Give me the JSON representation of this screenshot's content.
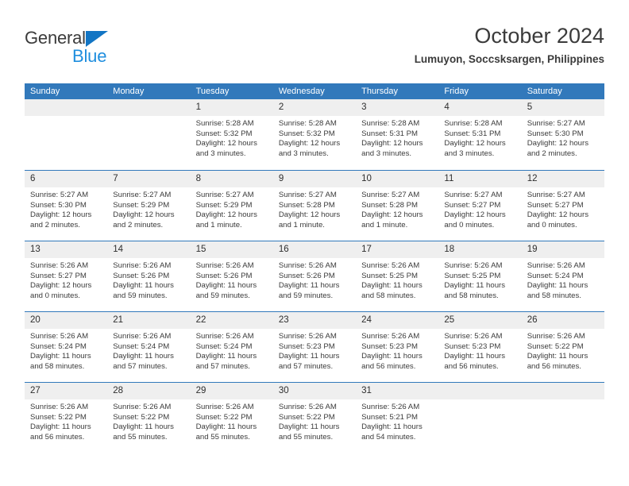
{
  "brand": {
    "name_top": "General",
    "name_bottom": "Blue",
    "colors": {
      "top_text": "#3b3b3b",
      "bottom_text": "#1f8ede",
      "triangle": "#1275c4"
    }
  },
  "header": {
    "title": "October 2024",
    "subtitle": "Lumuyon, Soccsksargen, Philippines"
  },
  "theme": {
    "header_blue": "#3279bb",
    "daynum_band": "#efefef",
    "text": "#3b3b3b"
  },
  "weekdays": [
    "Sunday",
    "Monday",
    "Tuesday",
    "Wednesday",
    "Thursday",
    "Friday",
    "Saturday"
  ],
  "weeks": [
    [
      {
        "day": "",
        "sunrise": "",
        "sunset": "",
        "daylight_line1": "",
        "daylight_line2": "",
        "empty": true
      },
      {
        "day": "",
        "sunrise": "",
        "sunset": "",
        "daylight_line1": "",
        "daylight_line2": "",
        "empty": true
      },
      {
        "day": "1",
        "sunrise": "Sunrise: 5:28 AM",
        "sunset": "Sunset: 5:32 PM",
        "daylight_line1": "Daylight: 12 hours",
        "daylight_line2": "and 3 minutes."
      },
      {
        "day": "2",
        "sunrise": "Sunrise: 5:28 AM",
        "sunset": "Sunset: 5:32 PM",
        "daylight_line1": "Daylight: 12 hours",
        "daylight_line2": "and 3 minutes."
      },
      {
        "day": "3",
        "sunrise": "Sunrise: 5:28 AM",
        "sunset": "Sunset: 5:31 PM",
        "daylight_line1": "Daylight: 12 hours",
        "daylight_line2": "and 3 minutes."
      },
      {
        "day": "4",
        "sunrise": "Sunrise: 5:28 AM",
        "sunset": "Sunset: 5:31 PM",
        "daylight_line1": "Daylight: 12 hours",
        "daylight_line2": "and 3 minutes."
      },
      {
        "day": "5",
        "sunrise": "Sunrise: 5:27 AM",
        "sunset": "Sunset: 5:30 PM",
        "daylight_line1": "Daylight: 12 hours",
        "daylight_line2": "and 2 minutes."
      }
    ],
    [
      {
        "day": "6",
        "sunrise": "Sunrise: 5:27 AM",
        "sunset": "Sunset: 5:30 PM",
        "daylight_line1": "Daylight: 12 hours",
        "daylight_line2": "and 2 minutes."
      },
      {
        "day": "7",
        "sunrise": "Sunrise: 5:27 AM",
        "sunset": "Sunset: 5:29 PM",
        "daylight_line1": "Daylight: 12 hours",
        "daylight_line2": "and 2 minutes."
      },
      {
        "day": "8",
        "sunrise": "Sunrise: 5:27 AM",
        "sunset": "Sunset: 5:29 PM",
        "daylight_line1": "Daylight: 12 hours",
        "daylight_line2": "and 1 minute."
      },
      {
        "day": "9",
        "sunrise": "Sunrise: 5:27 AM",
        "sunset": "Sunset: 5:28 PM",
        "daylight_line1": "Daylight: 12 hours",
        "daylight_line2": "and 1 minute."
      },
      {
        "day": "10",
        "sunrise": "Sunrise: 5:27 AM",
        "sunset": "Sunset: 5:28 PM",
        "daylight_line1": "Daylight: 12 hours",
        "daylight_line2": "and 1 minute."
      },
      {
        "day": "11",
        "sunrise": "Sunrise: 5:27 AM",
        "sunset": "Sunset: 5:27 PM",
        "daylight_line1": "Daylight: 12 hours",
        "daylight_line2": "and 0 minutes."
      },
      {
        "day": "12",
        "sunrise": "Sunrise: 5:27 AM",
        "sunset": "Sunset: 5:27 PM",
        "daylight_line1": "Daylight: 12 hours",
        "daylight_line2": "and 0 minutes."
      }
    ],
    [
      {
        "day": "13",
        "sunrise": "Sunrise: 5:26 AM",
        "sunset": "Sunset: 5:27 PM",
        "daylight_line1": "Daylight: 12 hours",
        "daylight_line2": "and 0 minutes."
      },
      {
        "day": "14",
        "sunrise": "Sunrise: 5:26 AM",
        "sunset": "Sunset: 5:26 PM",
        "daylight_line1": "Daylight: 11 hours",
        "daylight_line2": "and 59 minutes."
      },
      {
        "day": "15",
        "sunrise": "Sunrise: 5:26 AM",
        "sunset": "Sunset: 5:26 PM",
        "daylight_line1": "Daylight: 11 hours",
        "daylight_line2": "and 59 minutes."
      },
      {
        "day": "16",
        "sunrise": "Sunrise: 5:26 AM",
        "sunset": "Sunset: 5:26 PM",
        "daylight_line1": "Daylight: 11 hours",
        "daylight_line2": "and 59 minutes."
      },
      {
        "day": "17",
        "sunrise": "Sunrise: 5:26 AM",
        "sunset": "Sunset: 5:25 PM",
        "daylight_line1": "Daylight: 11 hours",
        "daylight_line2": "and 58 minutes."
      },
      {
        "day": "18",
        "sunrise": "Sunrise: 5:26 AM",
        "sunset": "Sunset: 5:25 PM",
        "daylight_line1": "Daylight: 11 hours",
        "daylight_line2": "and 58 minutes."
      },
      {
        "day": "19",
        "sunrise": "Sunrise: 5:26 AM",
        "sunset": "Sunset: 5:24 PM",
        "daylight_line1": "Daylight: 11 hours",
        "daylight_line2": "and 58 minutes."
      }
    ],
    [
      {
        "day": "20",
        "sunrise": "Sunrise: 5:26 AM",
        "sunset": "Sunset: 5:24 PM",
        "daylight_line1": "Daylight: 11 hours",
        "daylight_line2": "and 58 minutes."
      },
      {
        "day": "21",
        "sunrise": "Sunrise: 5:26 AM",
        "sunset": "Sunset: 5:24 PM",
        "daylight_line1": "Daylight: 11 hours",
        "daylight_line2": "and 57 minutes."
      },
      {
        "day": "22",
        "sunrise": "Sunrise: 5:26 AM",
        "sunset": "Sunset: 5:24 PM",
        "daylight_line1": "Daylight: 11 hours",
        "daylight_line2": "and 57 minutes."
      },
      {
        "day": "23",
        "sunrise": "Sunrise: 5:26 AM",
        "sunset": "Sunset: 5:23 PM",
        "daylight_line1": "Daylight: 11 hours",
        "daylight_line2": "and 57 minutes."
      },
      {
        "day": "24",
        "sunrise": "Sunrise: 5:26 AM",
        "sunset": "Sunset: 5:23 PM",
        "daylight_line1": "Daylight: 11 hours",
        "daylight_line2": "and 56 minutes."
      },
      {
        "day": "25",
        "sunrise": "Sunrise: 5:26 AM",
        "sunset": "Sunset: 5:23 PM",
        "daylight_line1": "Daylight: 11 hours",
        "daylight_line2": "and 56 minutes."
      },
      {
        "day": "26",
        "sunrise": "Sunrise: 5:26 AM",
        "sunset": "Sunset: 5:22 PM",
        "daylight_line1": "Daylight: 11 hours",
        "daylight_line2": "and 56 minutes."
      }
    ],
    [
      {
        "day": "27",
        "sunrise": "Sunrise: 5:26 AM",
        "sunset": "Sunset: 5:22 PM",
        "daylight_line1": "Daylight: 11 hours",
        "daylight_line2": "and 56 minutes."
      },
      {
        "day": "28",
        "sunrise": "Sunrise: 5:26 AM",
        "sunset": "Sunset: 5:22 PM",
        "daylight_line1": "Daylight: 11 hours",
        "daylight_line2": "and 55 minutes."
      },
      {
        "day": "29",
        "sunrise": "Sunrise: 5:26 AM",
        "sunset": "Sunset: 5:22 PM",
        "daylight_line1": "Daylight: 11 hours",
        "daylight_line2": "and 55 minutes."
      },
      {
        "day": "30",
        "sunrise": "Sunrise: 5:26 AM",
        "sunset": "Sunset: 5:22 PM",
        "daylight_line1": "Daylight: 11 hours",
        "daylight_line2": "and 55 minutes."
      },
      {
        "day": "31",
        "sunrise": "Sunrise: 5:26 AM",
        "sunset": "Sunset: 5:21 PM",
        "daylight_line1": "Daylight: 11 hours",
        "daylight_line2": "and 54 minutes."
      },
      {
        "day": "",
        "sunrise": "",
        "sunset": "",
        "daylight_line1": "",
        "daylight_line2": "",
        "empty": true
      },
      {
        "day": "",
        "sunrise": "",
        "sunset": "",
        "daylight_line1": "",
        "daylight_line2": "",
        "empty": true
      }
    ]
  ]
}
